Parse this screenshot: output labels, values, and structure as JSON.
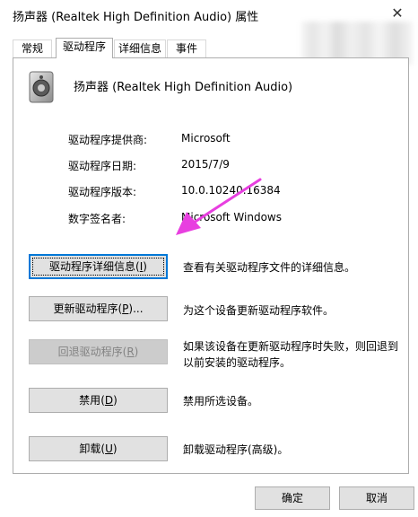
{
  "window": {
    "title": "扬声器 (Realtek High Definition Audio) 属性"
  },
  "tabs": [
    {
      "label": "常规"
    },
    {
      "label": "驱动程序"
    },
    {
      "label": "详细信息"
    },
    {
      "label": "事件"
    }
  ],
  "device": {
    "name": "扬声器 (Realtek High Definition Audio)",
    "icon": "speaker-icon"
  },
  "properties": [
    {
      "label": "驱动程序提供商:",
      "value": "Microsoft"
    },
    {
      "label": "驱动程序日期:",
      "value": "2015/7/9"
    },
    {
      "label": "驱动程序版本:",
      "value": "10.0.10240.16384"
    },
    {
      "label": "数字签名者:",
      "value": "Microsoft Windows"
    }
  ],
  "actions": [
    {
      "label": "驱动程序详细信息",
      "accesskey": "I",
      "description": "查看有关驱动程序文件的详细信息。"
    },
    {
      "label": "更新驱动程序",
      "accesskey": "P",
      "suffix": "...",
      "description": "为这个设备更新驱动程序软件。"
    },
    {
      "label": "回退驱动程序",
      "accesskey": "R",
      "description": "如果该设备在更新驱动程序时失败，则回退到以前安装的驱动程序。"
    },
    {
      "label": "禁用",
      "accesskey": "D",
      "description": "禁用所选设备。"
    },
    {
      "label": "卸载",
      "accesskey": "U",
      "description": "卸载驱动程序(高级)。"
    }
  ],
  "footer": {
    "ok_label": "确定",
    "cancel_label": "取消"
  },
  "colors": {
    "annotation_arrow": "#e83fe0",
    "focus_border": "#0078d7"
  }
}
